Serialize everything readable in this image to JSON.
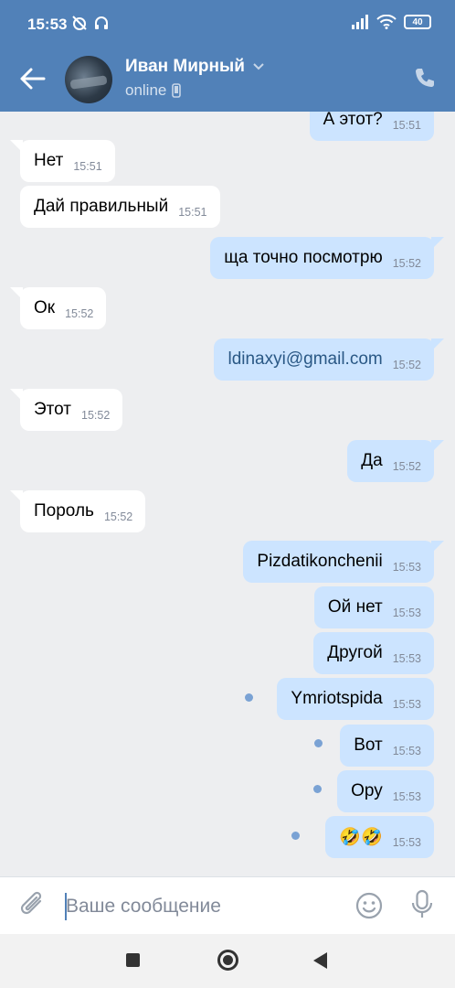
{
  "status_bar": {
    "time": "15:53",
    "battery": "40"
  },
  "chat_header": {
    "name": "Иван Мирный",
    "presence": "online"
  },
  "messages": [
    {
      "dir": "out",
      "text": "А этот?",
      "time": "15:51"
    },
    {
      "dir": "in",
      "text": "Нет",
      "time": "15:51"
    },
    {
      "dir": "in",
      "text": "Дай правильный",
      "time": "15:51"
    },
    {
      "dir": "out",
      "text": "ща точно посмотрю",
      "time": "15:52"
    },
    {
      "dir": "in",
      "text": "Ок",
      "time": "15:52"
    },
    {
      "dir": "out",
      "text": "ldinaxyi@gmail.com",
      "time": "15:52"
    },
    {
      "dir": "in",
      "text": "Этот",
      "time": "15:52"
    },
    {
      "dir": "out",
      "text": "Да",
      "time": "15:52"
    },
    {
      "dir": "in",
      "text": "Пороль",
      "time": "15:52"
    },
    {
      "dir": "out",
      "text": "Pizdatikonchenii",
      "time": "15:53"
    },
    {
      "dir": "out",
      "text": "Ой нет",
      "time": "15:53"
    },
    {
      "dir": "out",
      "text": "Другой",
      "time": "15:53"
    },
    {
      "dir": "out",
      "text": "Ymriotspida",
      "time": "15:53"
    },
    {
      "dir": "out",
      "text": "Вот",
      "time": "15:53"
    },
    {
      "dir": "out",
      "text": "Ору",
      "time": "15:53"
    },
    {
      "dir": "out",
      "text": "🤣🤣",
      "time": "15:53"
    }
  ],
  "composer": {
    "placeholder": "Ваше сообщение"
  },
  "colors": {
    "header": "#5181b8",
    "outgoing_bubble": "#cce4ff",
    "incoming_bubble": "#ffffff",
    "background": "#edeef0",
    "link": "#2a5885",
    "unread_dot": "#7aa2d4"
  },
  "icons": [
    "back-arrow-icon",
    "phone-icon",
    "chevron-down-icon",
    "mobile-icon",
    "paperclip-icon",
    "smile-icon",
    "microphone-icon",
    "wifi-icon",
    "signal-icon"
  ]
}
